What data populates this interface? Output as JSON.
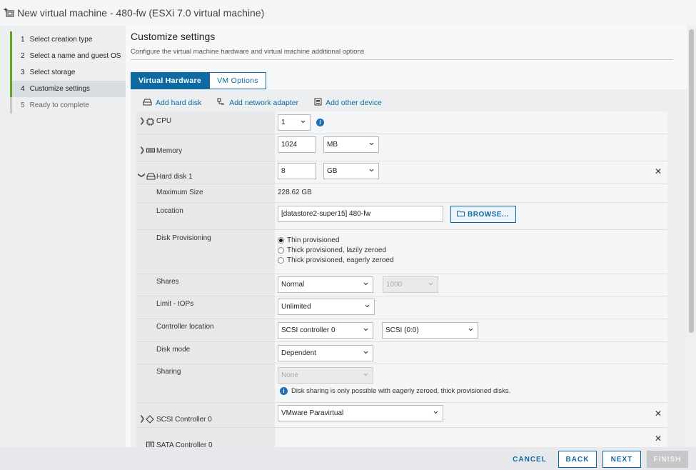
{
  "window": {
    "title": "New virtual machine - 480-fw (ESXi 7.0 virtual machine)"
  },
  "steps": [
    {
      "num": "1",
      "label": "Select creation type",
      "state": "done"
    },
    {
      "num": "2",
      "label": "Select a name and guest OS",
      "state": "done"
    },
    {
      "num": "3",
      "label": "Select storage",
      "state": "done"
    },
    {
      "num": "4",
      "label": "Customize settings",
      "state": "active"
    },
    {
      "num": "5",
      "label": "Ready to complete",
      "state": "pending"
    }
  ],
  "main": {
    "title": "Customize settings",
    "subtitle": "Configure the virtual machine hardware and virtual machine additional options"
  },
  "tabs": [
    {
      "label": "Virtual Hardware",
      "selected": true
    },
    {
      "label": "VM Options",
      "selected": false
    }
  ],
  "toolbar": {
    "add_hard_disk": "Add hard disk",
    "add_network_adapter": "Add network adapter",
    "add_other_device": "Add other device"
  },
  "hardware": {
    "cpu": {
      "label": "CPU",
      "value": "1"
    },
    "memory": {
      "label": "Memory",
      "value": "1024",
      "unit": "MB"
    },
    "hard_disk": {
      "label": "Hard disk 1",
      "size": "8",
      "unit": "GB",
      "max_size_label": "Maximum Size",
      "max_size_value": "228.62 GB",
      "location_label": "Location",
      "location_value": "[datastore2-super15] 480-fw",
      "browse_label": "BROWSE...",
      "provisioning_label": "Disk Provisioning",
      "provisioning_options": [
        {
          "label": "Thin provisioned",
          "selected": true
        },
        {
          "label": "Thick provisioned, lazily zeroed",
          "selected": false
        },
        {
          "label": "Thick provisioned, eagerly zeroed",
          "selected": false
        }
      ],
      "shares_label": "Shares",
      "shares_value": "Normal",
      "shares_number": "1000",
      "limit_label": "Limit - IOPs",
      "limit_value": "Unlimited",
      "controller_label": "Controller location",
      "controller_value": "SCSI controller 0",
      "controller_slot": "SCSI (0:0)",
      "disk_mode_label": "Disk mode",
      "disk_mode_value": "Dependent",
      "sharing_label": "Sharing",
      "sharing_value": "None",
      "sharing_note": "Disk sharing is only possible with eagerly zeroed, thick provisioned disks."
    },
    "scsi_controller": {
      "label": "SCSI Controller 0",
      "value": "VMware Paravirtual"
    },
    "sata_controller": {
      "label": "SATA Controller 0"
    }
  },
  "footer": {
    "cancel": "CANCEL",
    "back": "BACK",
    "next": "NEXT",
    "finish": "FINISH"
  },
  "colors": {
    "accent": "#0e6aa0",
    "step_done": "#62a420",
    "info": "#1e6fb8"
  }
}
